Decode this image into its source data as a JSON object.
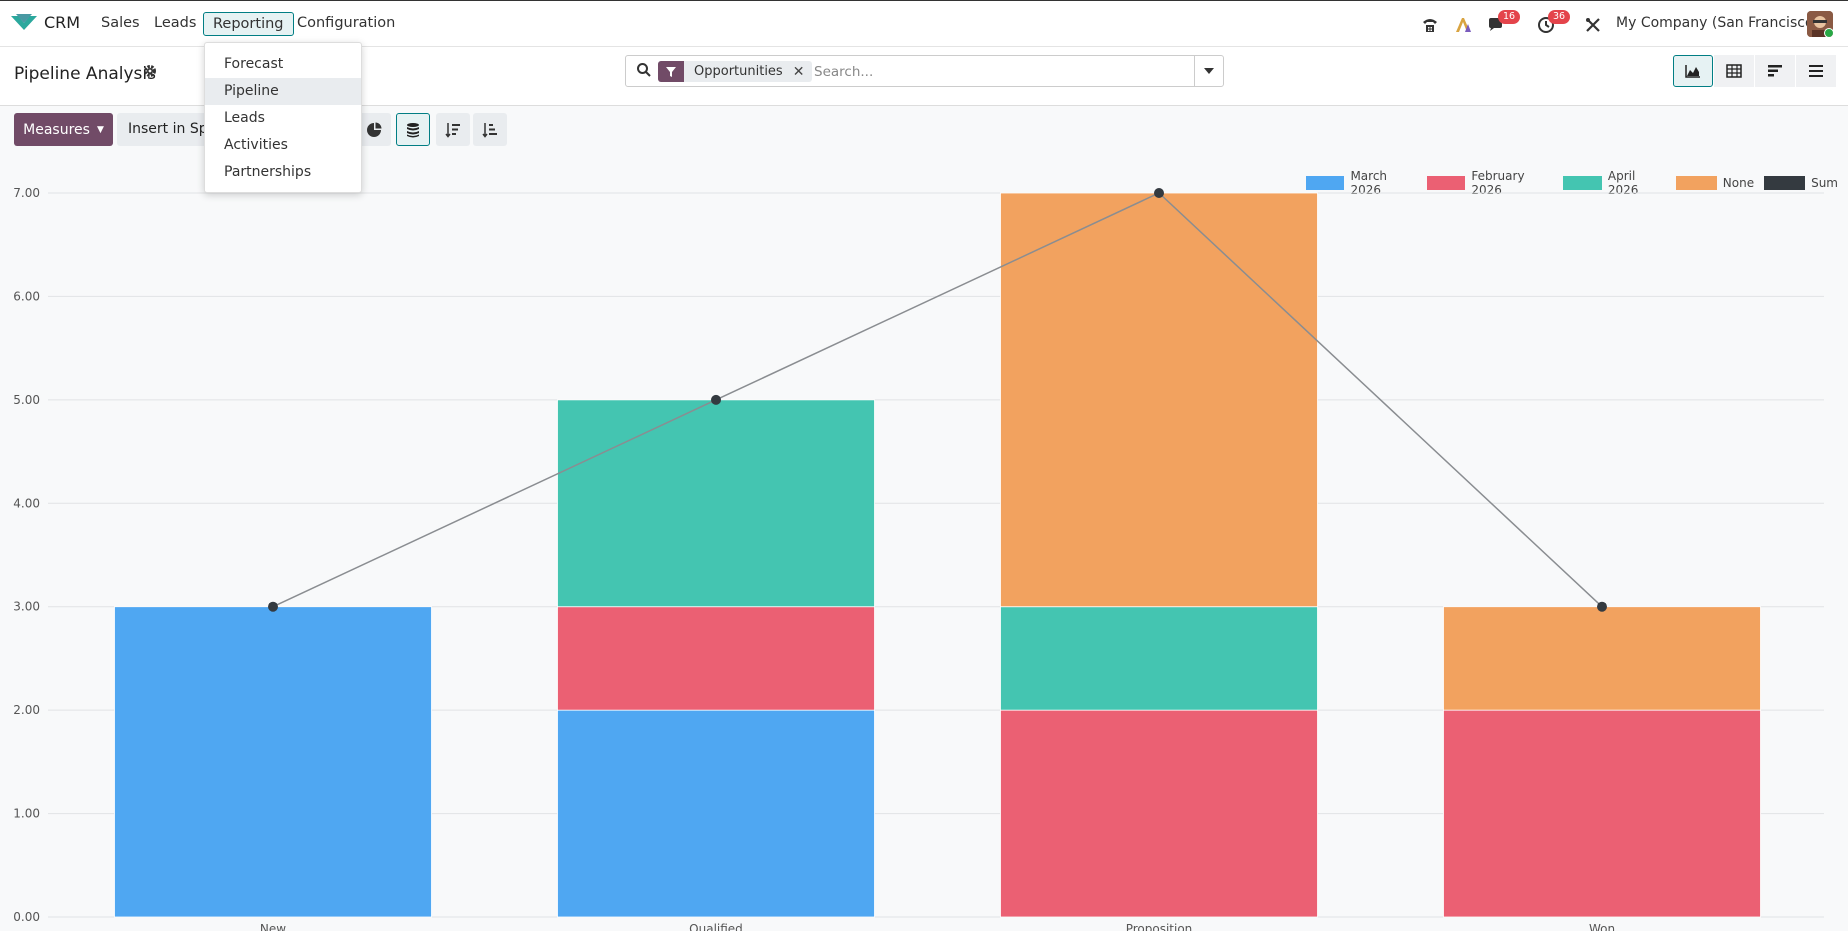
{
  "navbar": {
    "app_name": "CRM",
    "menu": [
      "Sales",
      "Leads",
      "Reporting",
      "Configuration"
    ],
    "active_menu": "Reporting",
    "messages_badge": "16",
    "activities_badge": "36",
    "company": "My Company (San Francisco)"
  },
  "reporting_menu": [
    "Forecast",
    "Pipeline",
    "Leads",
    "Activities",
    "Partnerships"
  ],
  "reporting_menu_active": "Pipeline",
  "control_panel": {
    "title": "Pipeline Analysis",
    "facet": "Opportunities",
    "search_placeholder": "Search...",
    "measures_label": "Measures",
    "spreadsheet_label": "Insert in Spreadsheet"
  },
  "colors": {
    "brand": "#714b67",
    "accent": "#017e84",
    "march": "#4fa7f2",
    "february": "#eb6073",
    "april": "#44c5b1",
    "none": "#f2a25f",
    "sum": "#343a40"
  },
  "chart_data": {
    "type": "bar",
    "stacked": true,
    "categories": [
      "New",
      "Qualified",
      "Proposition",
      "Won"
    ],
    "series": [
      {
        "name": "March 2026",
        "values": [
          3,
          2,
          0,
          0
        ]
      },
      {
        "name": "February 2026",
        "values": [
          0,
          1,
          2,
          2
        ]
      },
      {
        "name": "April 2026",
        "values": [
          0,
          2,
          1,
          0
        ]
      },
      {
        "name": "None",
        "values": [
          0,
          0,
          4,
          1
        ]
      }
    ],
    "line_series": {
      "name": "Sum",
      "values": [
        3,
        5,
        7,
        3
      ]
    },
    "ylim": [
      0,
      7
    ],
    "yticks": [
      "0.00",
      "1.00",
      "2.00",
      "3.00",
      "4.00",
      "5.00",
      "6.00",
      "7.00"
    ],
    "legend_position": "top-right",
    "grid": true
  }
}
